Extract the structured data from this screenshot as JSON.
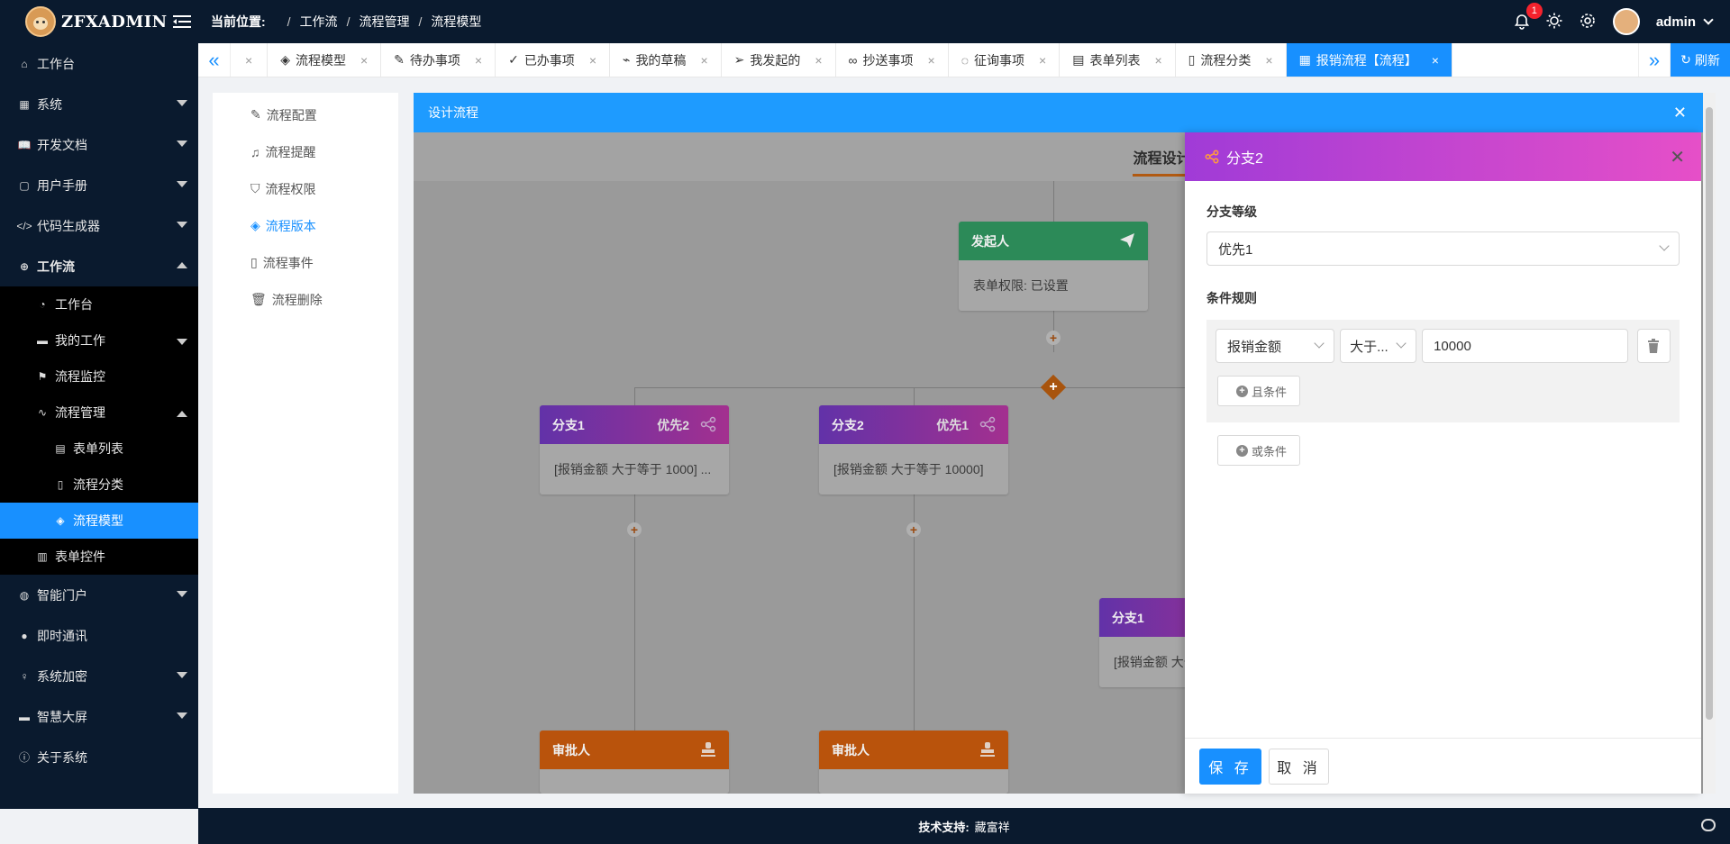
{
  "app": {
    "logo_text": "ZFXADMIN"
  },
  "header": {
    "location_label": "当前位置:",
    "breadcrumb": [
      "工作流",
      "流程管理",
      "流程模型"
    ],
    "notification_count": "1",
    "username": "admin"
  },
  "sidebar": {
    "items": [
      {
        "label": "工作台"
      },
      {
        "label": "系统"
      },
      {
        "label": "开发文档"
      },
      {
        "label": "用户手册"
      },
      {
        "label": "代码生成器"
      },
      {
        "label": "工作流"
      },
      {
        "label": "工作台"
      },
      {
        "label": "我的工作"
      },
      {
        "label": "流程监控"
      },
      {
        "label": "流程管理"
      },
      {
        "label": "表单列表"
      },
      {
        "label": "流程分类"
      },
      {
        "label": "流程模型"
      },
      {
        "label": "表单控件"
      },
      {
        "label": "智能门户"
      },
      {
        "label": "即时通讯"
      },
      {
        "label": "系统加密"
      },
      {
        "label": "智慧大屏"
      },
      {
        "label": "关于系统"
      }
    ]
  },
  "tabs": {
    "items": [
      {
        "label": "流程模型"
      },
      {
        "label": "待办事项"
      },
      {
        "label": "已办事项"
      },
      {
        "label": "我的草稿"
      },
      {
        "label": "我发起的"
      },
      {
        "label": "抄送事项"
      },
      {
        "label": "征询事项"
      },
      {
        "label": "表单列表"
      },
      {
        "label": "流程分类"
      },
      {
        "label": "报销流程【流程】"
      }
    ],
    "refresh_label": "刷新"
  },
  "left_menu": {
    "items": [
      {
        "label": "流程配置"
      },
      {
        "label": "流程提醒"
      },
      {
        "label": "流程权限"
      },
      {
        "label": "流程版本"
      },
      {
        "label": "流程事件"
      },
      {
        "label": "流程删除"
      }
    ]
  },
  "designer": {
    "title": "设计流程",
    "canvas_tab": "流程设计",
    "starter": {
      "title": "发起人",
      "body": "表单权限: 已设置"
    },
    "branch1": {
      "title": "分支1",
      "priority": "优先2",
      "body": "[报销金额 大于等于 1000] ..."
    },
    "branch2": {
      "title": "分支2",
      "priority": "优先1",
      "body": "[报销金额 大于等于 10000]"
    },
    "branch_nested": {
      "title": "分支1",
      "body": "[报销金额 大于..."
    },
    "approver1": {
      "title": "审批人"
    },
    "approver2": {
      "title": "审批人"
    }
  },
  "drawer": {
    "title": "分支2",
    "priority_label": "分支等级",
    "priority_value": "优先1",
    "rules_label": "条件规则",
    "rule_field": "报销金额",
    "rule_operator": "大于...",
    "rule_value": "10000",
    "and_condition": "且条件",
    "or_condition": "或条件",
    "save_label": "保 存",
    "cancel_label": "取 消"
  },
  "footer": {
    "tech_label": "技术支持:",
    "tech_value": "藏富祥"
  },
  "colors": {
    "accent": "#1890ff",
    "sidebar": "#0a1a2e",
    "starter": "#2c8a58",
    "approver": "#b9530c"
  }
}
